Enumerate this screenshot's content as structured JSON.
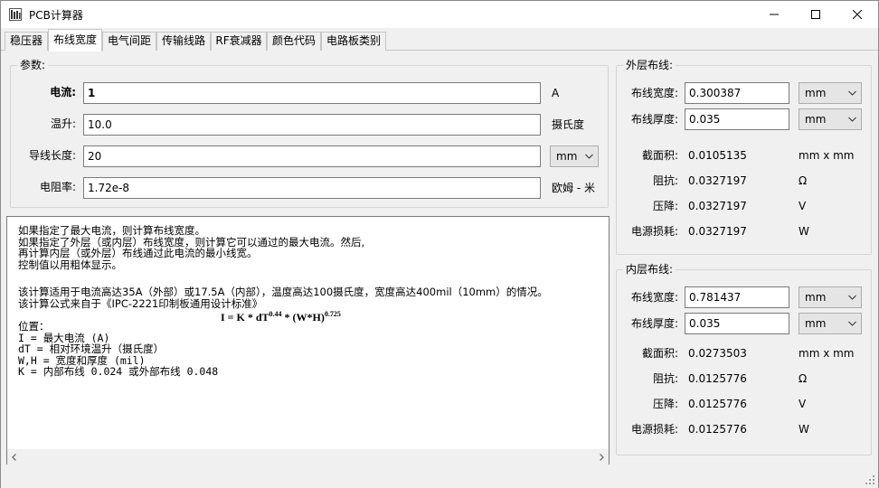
{
  "window": {
    "title": "PCB计算器",
    "icons": {
      "app": "calculator-app-icon",
      "minimize": "minimize-icon",
      "maximize": "maximize-icon",
      "close": "close-icon"
    }
  },
  "tabs": [
    {
      "label": "稳压器",
      "active": false
    },
    {
      "label": "布线宽度",
      "active": true
    },
    {
      "label": "电气间距",
      "active": false
    },
    {
      "label": "传输线路",
      "active": false
    },
    {
      "label": "RF衰减器",
      "active": false
    },
    {
      "label": "颜色代码",
      "active": false
    },
    {
      "label": "电路板类别",
      "active": false
    }
  ],
  "params": {
    "title": "参数:",
    "current": {
      "label": "电流:",
      "value": "1",
      "unit": "A"
    },
    "temp_rise": {
      "label": "温升:",
      "value": "10.0",
      "unit": "摄氏度"
    },
    "length": {
      "label": "导线长度:",
      "value": "20",
      "unit": "mm"
    },
    "resistivity": {
      "label": "电阻率:",
      "value": "1.72e-8",
      "unit": "欧姆 - 米"
    }
  },
  "description": {
    "intro": [
      "如果指定了最大电流，则计算布线宽度。",
      "如果指定了外层（或内层）布线宽度，则计算它可以通过的最大电流。然后,",
      "再计算内层（或外层）布线通过此电流的最小线宽。",
      "控制值以用粗体显示。"
    ],
    "scope": [
      "该计算适用于电流高达35A（外部）或17.5A（内部），温度高达100摄氏度，宽度高达400mil（10mm）的情况。",
      "该计算公式来自于《IPC-2221印制板通用设计标准》"
    ],
    "formula": {
      "main": "I = K * dT",
      "exp1": "0.44",
      "mid": " * (W*H)",
      "exp2": "0.725"
    },
    "legend": [
      "位置：",
      "I = 最大电流 (A)",
      "dT = 相对环境温升（摄氏度）",
      "W,H = 宽度和厚度 (mil)",
      "K = 内部布线 0.024 或外部布线 0.048"
    ]
  },
  "external": {
    "title": "外层布线:",
    "width": {
      "label": "布线宽度:",
      "value": "0.300387",
      "unit": "mm"
    },
    "thickness": {
      "label": "布线厚度:",
      "value": "0.035",
      "unit": "mm"
    },
    "area": {
      "label": "截面积:",
      "value": "0.0105135",
      "unit": "mm x mm"
    },
    "resistance": {
      "label": "阻抗:",
      "value": "0.0327197",
      "unit": "Ω"
    },
    "voltage_drop": {
      "label": "压降:",
      "value": "0.0327197",
      "unit": "V"
    },
    "power_loss": {
      "label": "电源损耗:",
      "value": "0.0327197",
      "unit": "W"
    }
  },
  "internal": {
    "title": "内层布线:",
    "width": {
      "label": "布线宽度:",
      "value": "0.781437",
      "unit": "mm"
    },
    "thickness": {
      "label": "布线厚度:",
      "value": "0.035",
      "unit": "mm"
    },
    "area": {
      "label": "截面积:",
      "value": "0.0273503",
      "unit": "mm x mm"
    },
    "resistance": {
      "label": "阻抗:",
      "value": "0.0125776",
      "unit": "Ω"
    },
    "voltage_drop": {
      "label": "压降:",
      "value": "0.0125776",
      "unit": "V"
    },
    "power_loss": {
      "label": "电源损耗:",
      "value": "0.0125776",
      "unit": "W"
    }
  }
}
